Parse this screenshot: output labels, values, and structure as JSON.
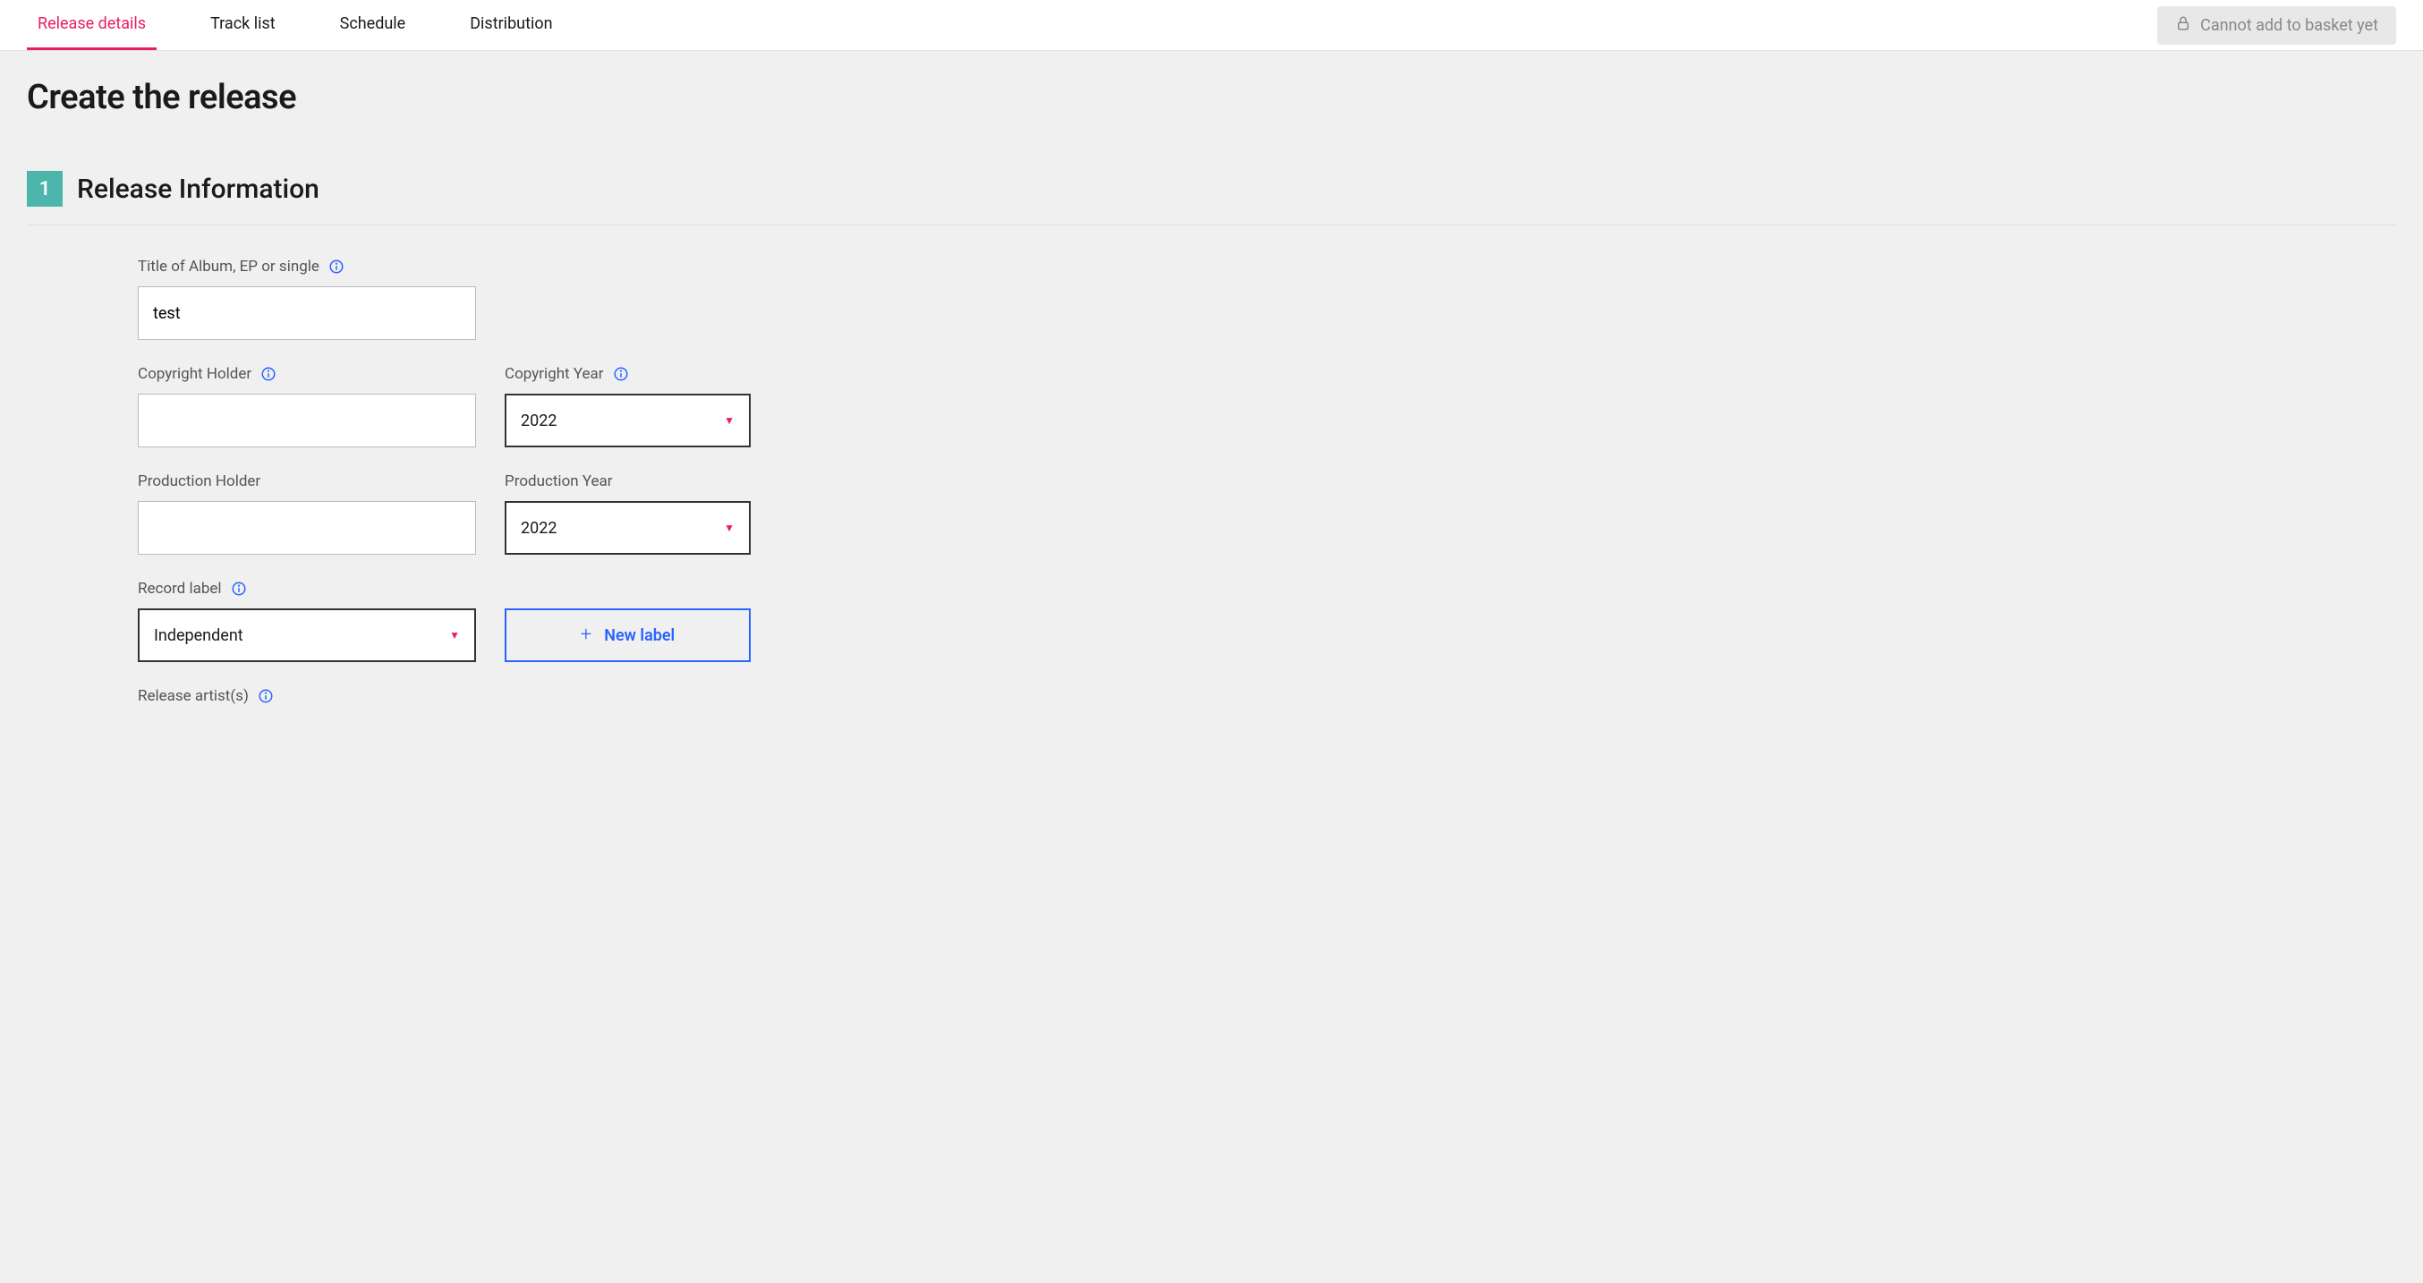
{
  "tabs": {
    "release_details": "Release details",
    "track_list": "Track list",
    "schedule": "Schedule",
    "distribution": "Distribution"
  },
  "basket_notice": "Cannot add to basket yet",
  "page_title": "Create the release",
  "section": {
    "number": "1",
    "title": "Release Information"
  },
  "fields": {
    "title": {
      "label": "Title of Album, EP or single",
      "value": "test"
    },
    "copyright_holder": {
      "label": "Copyright Holder",
      "value": ""
    },
    "copyright_year": {
      "label": "Copyright Year",
      "value": "2022"
    },
    "production_holder": {
      "label": "Production Holder",
      "value": ""
    },
    "production_year": {
      "label": "Production Year",
      "value": "2022"
    },
    "record_label": {
      "label": "Record label",
      "value": "Independent"
    },
    "new_label": "New label",
    "release_artists": {
      "label": "Release artist(s)"
    }
  }
}
